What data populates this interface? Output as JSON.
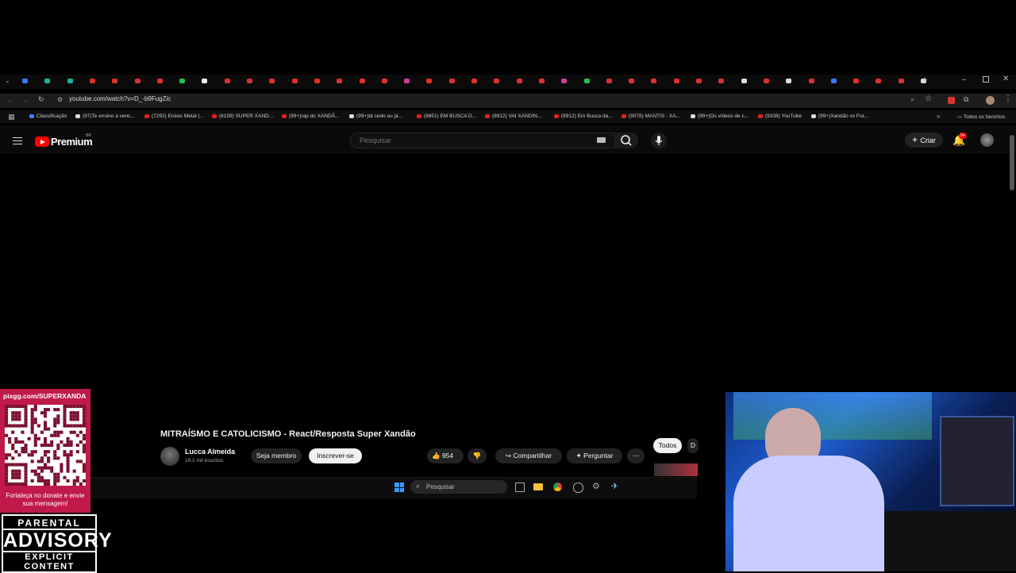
{
  "browser": {
    "url": "youtube.com/watch?v=D_-b9FugZic",
    "bookmarks": [
      "Classificação",
      "(97)Te ensino a venc...",
      "(7292) Enéas Metal |...",
      "(8159) SUPER XAND...",
      "(99+)rap do XANDÃ...",
      "(99+)tá cedo ou já...",
      "(8851) EM BUSCA D...",
      "(8912) VAI XANDIN...",
      "(8912) Em Busca da...",
      "(9078) MANTIS - XA...",
      "(99+)Os vídeos de c...",
      "(9338) YouTube",
      "(99+)Xandão vs Fra..."
    ],
    "all_favorites": "Todos os favoritos"
  },
  "youtube": {
    "logo_text": "Premium",
    "region": "BR",
    "search_placeholder": "Pesquisar",
    "create_label": "Criar",
    "notification_count": "9+"
  },
  "video": {
    "title": "MITRAÍSMO E CATOLICISMO - React/Resposta Super Xandão",
    "channel": "Lucca Almeida",
    "subscribers": "19,1 mil inscritos",
    "join_label": "Seja membro",
    "subscribe_label": "Inscrever-se",
    "likes": "954",
    "share_label": "Compartilhar",
    "ask_label": "Perguntar",
    "chips": [
      "Todos",
      "D"
    ]
  },
  "taskbar": {
    "search_placeholder": "Pesquisar"
  },
  "overlay": {
    "pix_url": "pixgg.com/SUPERXANDA",
    "pix_message": "Fortaleça no donate e envie sua mensagem!",
    "advisory_line1": "PARENTAL",
    "advisory_line2": "ADVISORY",
    "advisory_line3": "EXPLICIT CONTENT"
  },
  "colors": {
    "youtube_red": "#ff0000",
    "pix_bg": "#c01a4a",
    "background": "#000000"
  }
}
